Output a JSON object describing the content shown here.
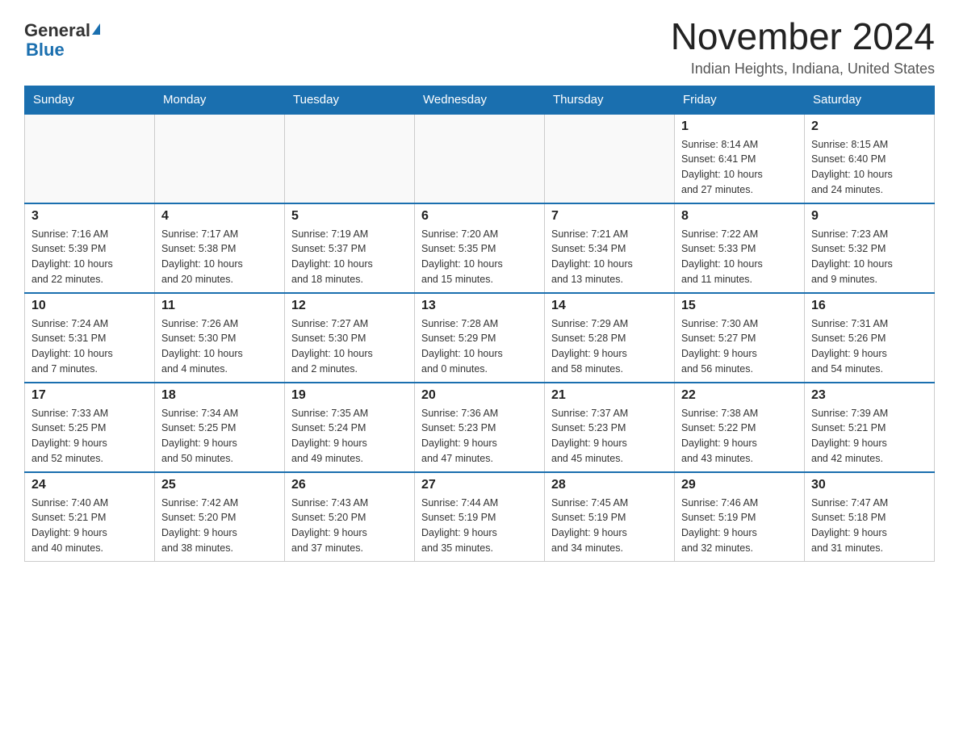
{
  "logo": {
    "general": "General",
    "blue": "Blue"
  },
  "title": "November 2024",
  "location": "Indian Heights, Indiana, United States",
  "weekdays": [
    "Sunday",
    "Monday",
    "Tuesday",
    "Wednesday",
    "Thursday",
    "Friday",
    "Saturday"
  ],
  "weeks": [
    [
      {
        "day": "",
        "info": ""
      },
      {
        "day": "",
        "info": ""
      },
      {
        "day": "",
        "info": ""
      },
      {
        "day": "",
        "info": ""
      },
      {
        "day": "",
        "info": ""
      },
      {
        "day": "1",
        "info": "Sunrise: 8:14 AM\nSunset: 6:41 PM\nDaylight: 10 hours\nand 27 minutes."
      },
      {
        "day": "2",
        "info": "Sunrise: 8:15 AM\nSunset: 6:40 PM\nDaylight: 10 hours\nand 24 minutes."
      }
    ],
    [
      {
        "day": "3",
        "info": "Sunrise: 7:16 AM\nSunset: 5:39 PM\nDaylight: 10 hours\nand 22 minutes."
      },
      {
        "day": "4",
        "info": "Sunrise: 7:17 AM\nSunset: 5:38 PM\nDaylight: 10 hours\nand 20 minutes."
      },
      {
        "day": "5",
        "info": "Sunrise: 7:19 AM\nSunset: 5:37 PM\nDaylight: 10 hours\nand 18 minutes."
      },
      {
        "day": "6",
        "info": "Sunrise: 7:20 AM\nSunset: 5:35 PM\nDaylight: 10 hours\nand 15 minutes."
      },
      {
        "day": "7",
        "info": "Sunrise: 7:21 AM\nSunset: 5:34 PM\nDaylight: 10 hours\nand 13 minutes."
      },
      {
        "day": "8",
        "info": "Sunrise: 7:22 AM\nSunset: 5:33 PM\nDaylight: 10 hours\nand 11 minutes."
      },
      {
        "day": "9",
        "info": "Sunrise: 7:23 AM\nSunset: 5:32 PM\nDaylight: 10 hours\nand 9 minutes."
      }
    ],
    [
      {
        "day": "10",
        "info": "Sunrise: 7:24 AM\nSunset: 5:31 PM\nDaylight: 10 hours\nand 7 minutes."
      },
      {
        "day": "11",
        "info": "Sunrise: 7:26 AM\nSunset: 5:30 PM\nDaylight: 10 hours\nand 4 minutes."
      },
      {
        "day": "12",
        "info": "Sunrise: 7:27 AM\nSunset: 5:30 PM\nDaylight: 10 hours\nand 2 minutes."
      },
      {
        "day": "13",
        "info": "Sunrise: 7:28 AM\nSunset: 5:29 PM\nDaylight: 10 hours\nand 0 minutes."
      },
      {
        "day": "14",
        "info": "Sunrise: 7:29 AM\nSunset: 5:28 PM\nDaylight: 9 hours\nand 58 minutes."
      },
      {
        "day": "15",
        "info": "Sunrise: 7:30 AM\nSunset: 5:27 PM\nDaylight: 9 hours\nand 56 minutes."
      },
      {
        "day": "16",
        "info": "Sunrise: 7:31 AM\nSunset: 5:26 PM\nDaylight: 9 hours\nand 54 minutes."
      }
    ],
    [
      {
        "day": "17",
        "info": "Sunrise: 7:33 AM\nSunset: 5:25 PM\nDaylight: 9 hours\nand 52 minutes."
      },
      {
        "day": "18",
        "info": "Sunrise: 7:34 AM\nSunset: 5:25 PM\nDaylight: 9 hours\nand 50 minutes."
      },
      {
        "day": "19",
        "info": "Sunrise: 7:35 AM\nSunset: 5:24 PM\nDaylight: 9 hours\nand 49 minutes."
      },
      {
        "day": "20",
        "info": "Sunrise: 7:36 AM\nSunset: 5:23 PM\nDaylight: 9 hours\nand 47 minutes."
      },
      {
        "day": "21",
        "info": "Sunrise: 7:37 AM\nSunset: 5:23 PM\nDaylight: 9 hours\nand 45 minutes."
      },
      {
        "day": "22",
        "info": "Sunrise: 7:38 AM\nSunset: 5:22 PM\nDaylight: 9 hours\nand 43 minutes."
      },
      {
        "day": "23",
        "info": "Sunrise: 7:39 AM\nSunset: 5:21 PM\nDaylight: 9 hours\nand 42 minutes."
      }
    ],
    [
      {
        "day": "24",
        "info": "Sunrise: 7:40 AM\nSunset: 5:21 PM\nDaylight: 9 hours\nand 40 minutes."
      },
      {
        "day": "25",
        "info": "Sunrise: 7:42 AM\nSunset: 5:20 PM\nDaylight: 9 hours\nand 38 minutes."
      },
      {
        "day": "26",
        "info": "Sunrise: 7:43 AM\nSunset: 5:20 PM\nDaylight: 9 hours\nand 37 minutes."
      },
      {
        "day": "27",
        "info": "Sunrise: 7:44 AM\nSunset: 5:19 PM\nDaylight: 9 hours\nand 35 minutes."
      },
      {
        "day": "28",
        "info": "Sunrise: 7:45 AM\nSunset: 5:19 PM\nDaylight: 9 hours\nand 34 minutes."
      },
      {
        "day": "29",
        "info": "Sunrise: 7:46 AM\nSunset: 5:19 PM\nDaylight: 9 hours\nand 32 minutes."
      },
      {
        "day": "30",
        "info": "Sunrise: 7:47 AM\nSunset: 5:18 PM\nDaylight: 9 hours\nand 31 minutes."
      }
    ]
  ]
}
